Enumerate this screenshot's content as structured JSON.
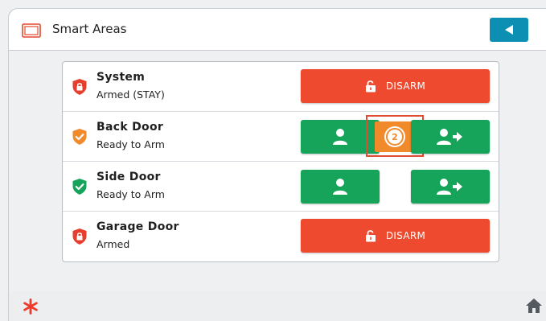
{
  "header": {
    "title": "Smart Areas",
    "icon": "panel-icon",
    "back_icon": "back-arrow-icon",
    "accent": "#0d8fb3"
  },
  "areas": [
    {
      "name": "System",
      "status": "Armed (STAY)",
      "shield_color": "#e53e2c",
      "shield_icon": "lock-shield-icon",
      "action": "disarm",
      "action_label": "DISARM"
    },
    {
      "name": "Back Door",
      "status": "Ready to Arm",
      "shield_color": "#f08a2b",
      "shield_icon": "check-shield-icon",
      "action": "arm",
      "countdown": "2"
    },
    {
      "name": "Side Door",
      "status": "Ready to Arm",
      "shield_color": "#16a35a",
      "shield_icon": "check-shield-icon",
      "action": "arm"
    },
    {
      "name": "Garage Door",
      "status": "Armed",
      "shield_color": "#e53e2c",
      "shield_icon": "lock-shield-icon",
      "action": "disarm",
      "action_label": "DISARM"
    }
  ],
  "colors": {
    "disarm": "#ee4a2f",
    "arm": "#16a35a",
    "countdown": "#f08a2b"
  },
  "footer": {
    "left_icon": "asterisk-icon",
    "right_icon": "home-icon"
  }
}
